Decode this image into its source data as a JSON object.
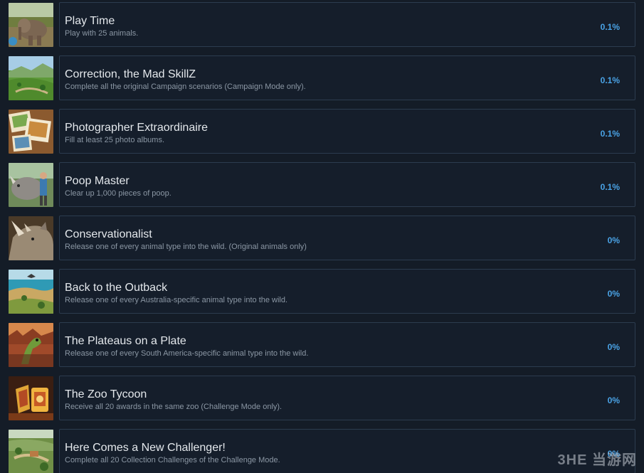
{
  "achievements": [
    {
      "title": "Play Time",
      "description": "Play with 25 animals.",
      "percent": "0.1%",
      "icon": "elephant-image"
    },
    {
      "title": "Correction, the Mad SkillZ",
      "description": "Complete all the original Campaign scenarios (Campaign Mode only).",
      "percent": "0.1%",
      "icon": "green-landscape-image"
    },
    {
      "title": "Photographer Extraordinaire",
      "description": "Fill at least 25 photo albums.",
      "percent": "0.1%",
      "icon": "photo-album-image"
    },
    {
      "title": "Poop Master",
      "description": "Clear up 1,000 pieces of poop.",
      "percent": "0.1%",
      "icon": "rhino-keeper-image"
    },
    {
      "title": "Conservationalist",
      "description": "Release one of every animal type into the wild. (Original animals only)",
      "percent": "0%",
      "icon": "rhino-head-image"
    },
    {
      "title": "Back to the Outback",
      "description": "Release one of every Australia-specific animal type into the wild.",
      "percent": "0%",
      "icon": "outback-coast-image"
    },
    {
      "title": "The Plateaus on a Plate",
      "description": "Release one of every South America-specific animal type into the wild.",
      "percent": "0%",
      "icon": "plateau-lizard-image"
    },
    {
      "title": "The Zoo Tycoon",
      "description": "Receive all 20 awards in the same zoo (Challenge Mode only).",
      "percent": "0%",
      "icon": "gold-trophy-image"
    },
    {
      "title": "Here Comes a New Challenger!",
      "description": "Complete all 20 Collection Challenges of the Challenge Mode.",
      "percent": "0%",
      "icon": "zoo-aerial-image"
    }
  ],
  "watermark": {
    "text": "3HE 当游网"
  }
}
